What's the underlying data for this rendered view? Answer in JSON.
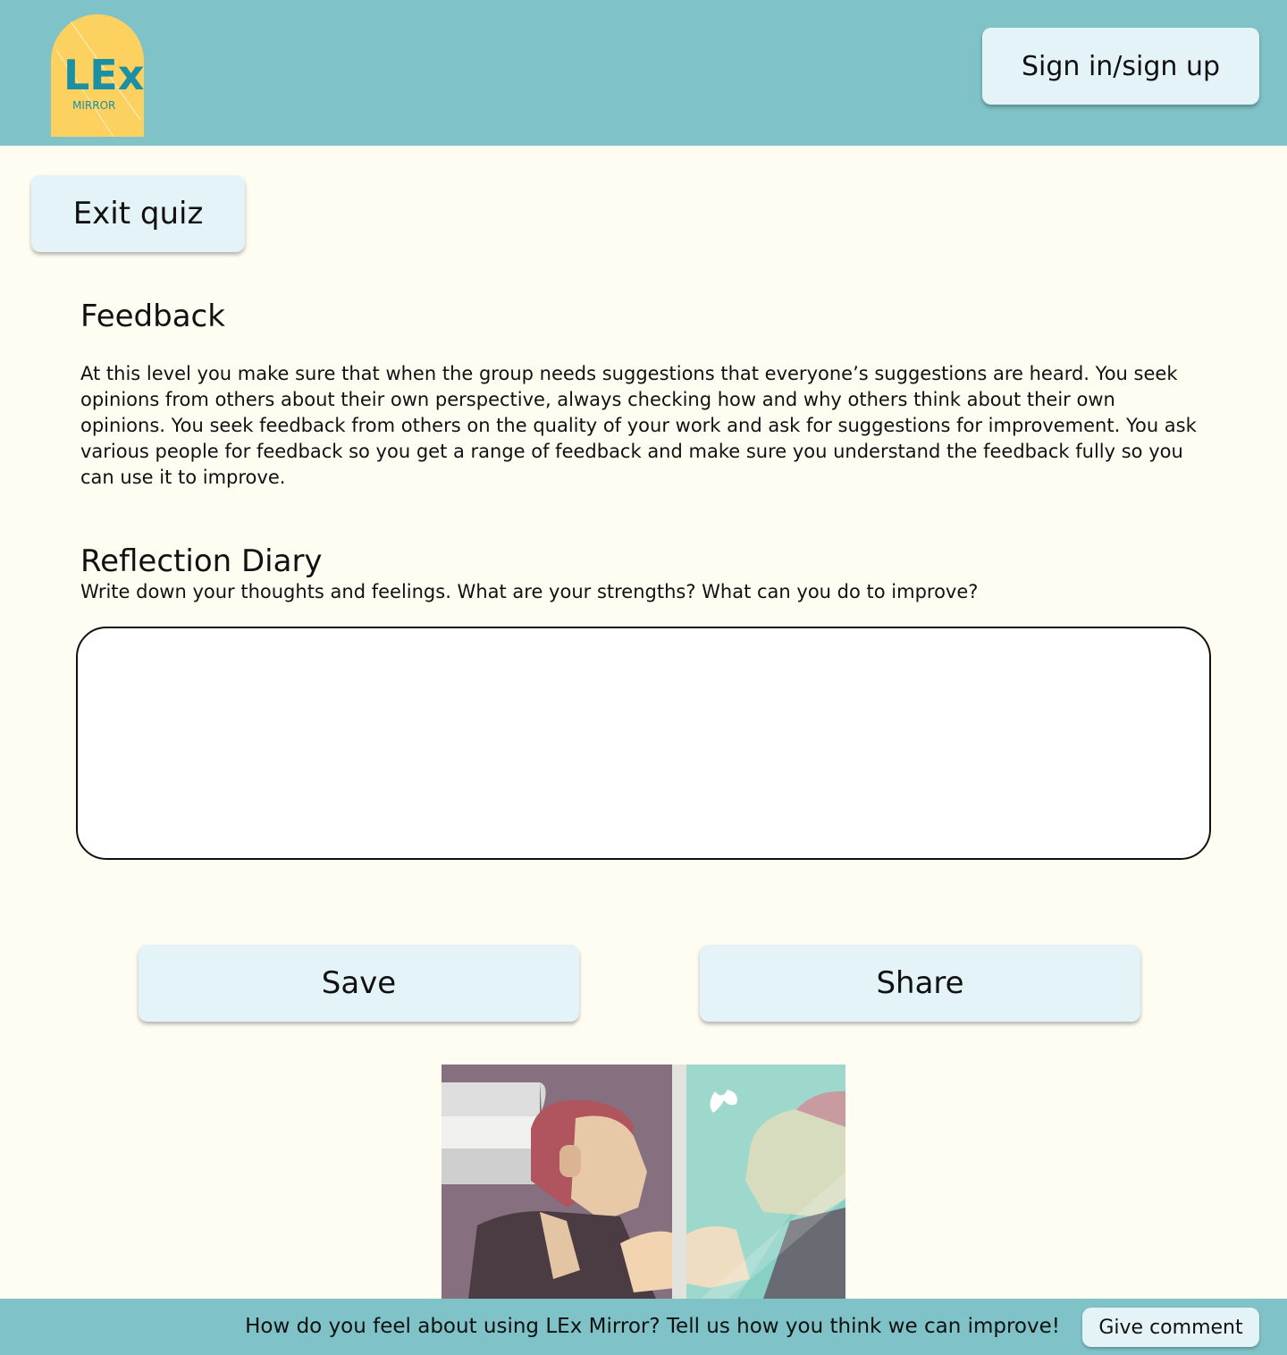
{
  "header": {
    "logo_main": "LEx",
    "logo_sub": "MIRROR",
    "signin_label": "Sign in/sign up"
  },
  "quiz": {
    "exit_label": "Exit quiz"
  },
  "feedback": {
    "heading": "Feedback",
    "text": "At this level you make sure that when the group needs suggestions that everyone’s suggestions are heard. You seek opinions from others about their own perspective, always checking how and why others think about their own opinions. You seek feedback from others on the quality of your work and ask for suggestions for improvement. You ask various people for feedback so you get a range of feedback and make sure you understand the feedback fully so you can use it to improve."
  },
  "diary": {
    "heading": "Reflection Diary",
    "prompt": "Write down your thoughts and feelings. What are your strengths? What can you do to improve?",
    "value": ""
  },
  "actions": {
    "save_label": "Save",
    "share_label": "Share"
  },
  "footer": {
    "text": "How do you feel about using LEx Mirror? Tell us how you think we can improve!",
    "comment_label": "Give comment"
  },
  "colors": {
    "header_bg": "#7fc2c7",
    "page_bg": "#fffcf2",
    "button_bg": "#e4f3f7",
    "logo_bg": "#fcd15f",
    "logo_text": "#1b8fa3"
  }
}
